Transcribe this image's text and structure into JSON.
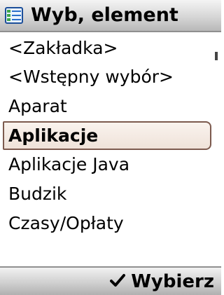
{
  "header": {
    "title": "Wyb, element",
    "icon": "list-icon"
  },
  "list": {
    "items": [
      {
        "label": "<Zakładka>"
      },
      {
        "label": "<Wstępny wybór>"
      },
      {
        "label": "Aparat"
      },
      {
        "label": "Aplikacje",
        "selected": true
      },
      {
        "label": "Aplikacje Java"
      },
      {
        "label": "Budzik"
      },
      {
        "label": "Czasy/Opłaty"
      }
    ]
  },
  "softkeys": {
    "right_label": "Wybierz",
    "right_icon": "checkmark-icon"
  },
  "colors": {
    "selection_border": "#7c5a4e",
    "selection_fill": "#f3e8e0",
    "icon_green": "#3fa64a",
    "icon_blue": "#2a6fc9"
  }
}
